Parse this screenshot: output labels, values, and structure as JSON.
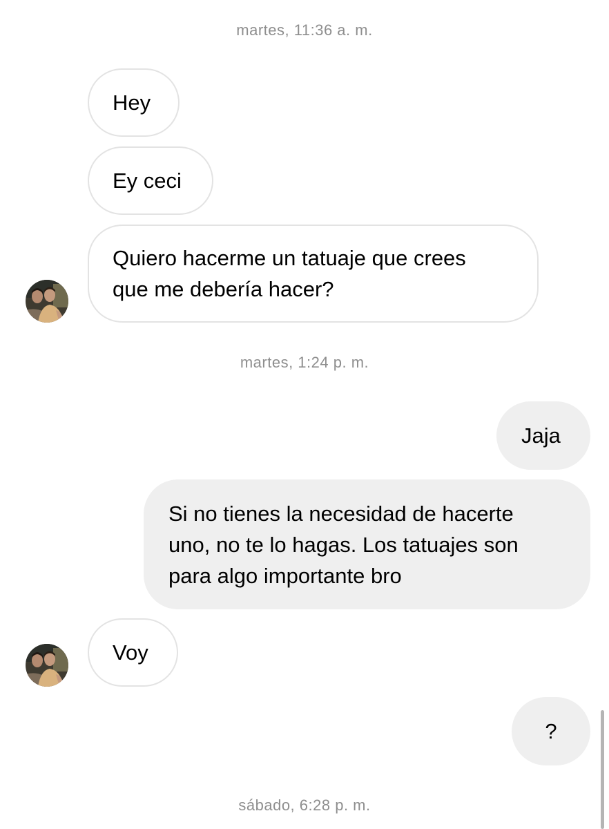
{
  "conversation": {
    "timestamps": [
      "martes, 11:36 a. m.",
      "martes, 1:24 p. m.",
      "sábado, 6:28 p. m."
    ],
    "messages": [
      {
        "text": "Hey",
        "direction": "incoming"
      },
      {
        "text": "Ey ceci",
        "direction": "incoming"
      },
      {
        "text": "Quiero hacerme un tatuaje que crees\nque me debería hacer?",
        "direction": "incoming"
      },
      {
        "text": "Jaja",
        "direction": "outgoing"
      },
      {
        "text": "Si no tienes la necesidad de hacerte\nuno, no te lo hagas. Los tatuajes son\npara algo importante bro",
        "direction": "outgoing"
      },
      {
        "text": "Voy",
        "direction": "incoming"
      },
      {
        "text": "?",
        "direction": "outgoing"
      }
    ]
  },
  "colors": {
    "incoming_border": "#e3e3e3",
    "outgoing_bg": "#efefef",
    "timestamp": "#8e8e8e"
  },
  "icons": {
    "avatar": "contact-profile-photo"
  }
}
